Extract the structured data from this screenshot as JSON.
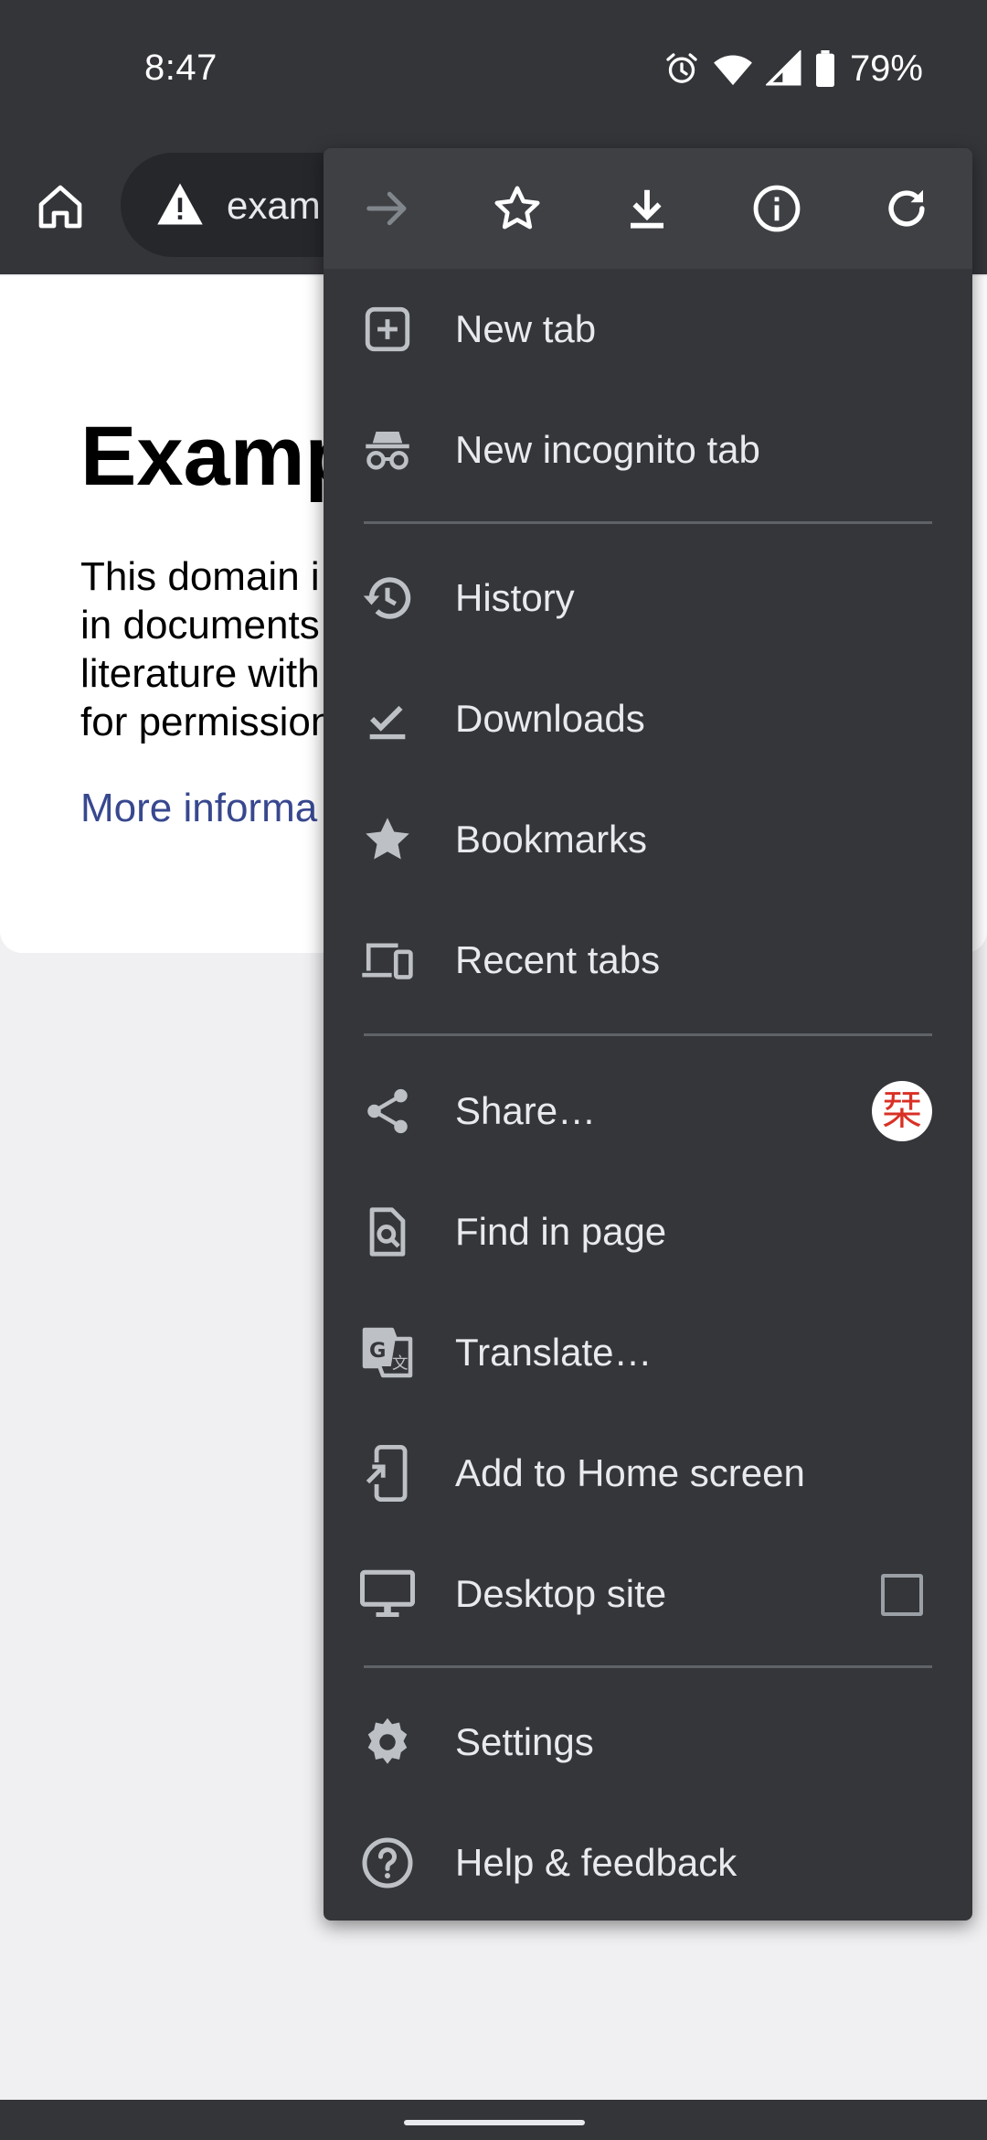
{
  "status_bar": {
    "time": "8:47",
    "battery": "79%",
    "icons": [
      "alarm-icon",
      "wifi-icon",
      "signal-icon",
      "battery-icon"
    ]
  },
  "toolbar": {
    "url": "exam"
  },
  "page": {
    "title": "Examp",
    "body_lines": [
      "This domain i",
      "in documents",
      "literature with",
      "for permission"
    ],
    "link": "More informa"
  },
  "menu": {
    "top_icons": [
      "forward-icon",
      "bookmark-star-icon",
      "download-icon",
      "info-icon",
      "refresh-icon"
    ],
    "items": [
      {
        "label": "New tab",
        "icon": "new-tab-icon"
      },
      {
        "label": "New incognito tab",
        "icon": "incognito-icon"
      },
      {
        "label": "History",
        "icon": "history-icon"
      },
      {
        "label": "Downloads",
        "icon": "downloads-icon"
      },
      {
        "label": "Bookmarks",
        "icon": "bookmarks-icon"
      },
      {
        "label": "Recent tabs",
        "icon": "recent-tabs-icon"
      },
      {
        "label": "Share…",
        "icon": "share-icon"
      },
      {
        "label": "Find in page",
        "icon": "find-in-page-icon"
      },
      {
        "label": "Translate…",
        "icon": "translate-icon"
      },
      {
        "label": "Add to Home screen",
        "icon": "add-to-home-icon"
      },
      {
        "label": "Desktop site",
        "icon": "desktop-icon"
      },
      {
        "label": "Settings",
        "icon": "settings-icon"
      },
      {
        "label": "Help & feedback",
        "icon": "help-icon"
      }
    ],
    "share_badge": "栞",
    "desktop_site_checked": false
  },
  "colors": {
    "chrome_dark": "#343539",
    "menu_bg": "#35363a",
    "menu_header": "#3e4044",
    "menu_text": "#e8eaed",
    "icon_gray": "#bdc1c6",
    "link_blue": "#38488f"
  }
}
